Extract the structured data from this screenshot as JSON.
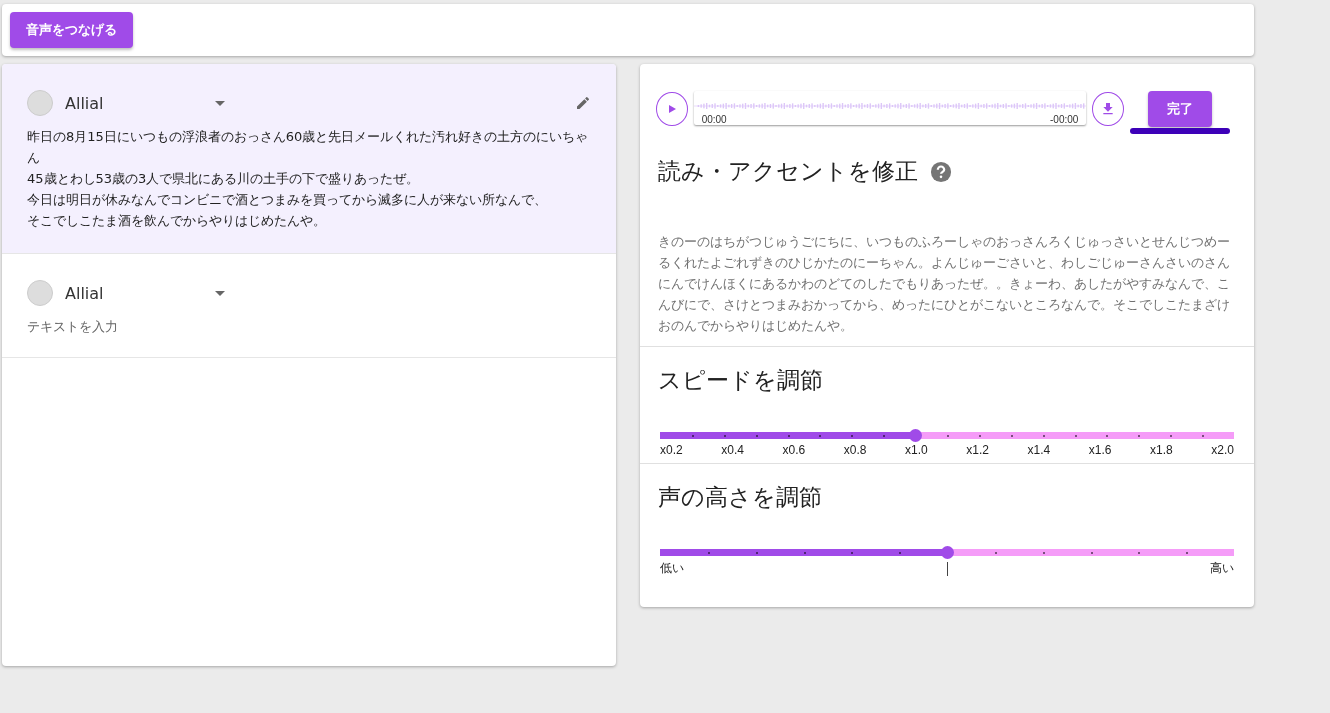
{
  "toolbar": {
    "connect_button": "音声をつなげる"
  },
  "items": [
    {
      "speaker": "Allial",
      "selected": true,
      "lines": [
        "昨日の8月15日にいつもの浮浪者のおっさん60歳と先日メールくれた汚れ好きの土方のにいちゃん",
        "45歳とわし53歳の3人で県北にある川の土手の下で盛りあったぜ。",
        "今日は明日が休みなんでコンビニで酒とつまみを買ってから滅多に人が来ない所なんで、",
        "そこでしこたま酒を飲んでからやりはじめたんや。"
      ]
    },
    {
      "speaker": "Allial",
      "selected": false,
      "placeholder": "テキストを入力"
    }
  ],
  "player": {
    "time_start": "00:00",
    "time_end": "-00:00",
    "done_button": "完了"
  },
  "reading": {
    "title": "読み・アクセントを修正",
    "text": "きのーのはちがつじゅうごにちに、いつものふろーしゃのおっさんろくじゅっさいとせんじつめーるくれたよごれずきのひじかたのにーちゃん。よんじゅーごさいと、わしごじゅーさんさいのさんにんでけんほくにあるかわのどてのしたでもりあったぜ。。きょーわ、あしたがやすみなんで、こんびにで、さけとつまみおかってから、めったにひとがこないところなんで。そこでしこたまざけおのんでからやりはじめたんや。"
  },
  "speed": {
    "title": "スピードを調節",
    "level": 0.444,
    "labels": [
      "x0.2",
      "x0.4",
      "x0.6",
      "x0.8",
      "x1.0",
      "x1.2",
      "x1.4",
      "x1.6",
      "x1.8",
      "x2.0"
    ]
  },
  "pitch": {
    "title": "声の高さを調節",
    "level": 0.5,
    "low": "低い",
    "high": "高い"
  }
}
